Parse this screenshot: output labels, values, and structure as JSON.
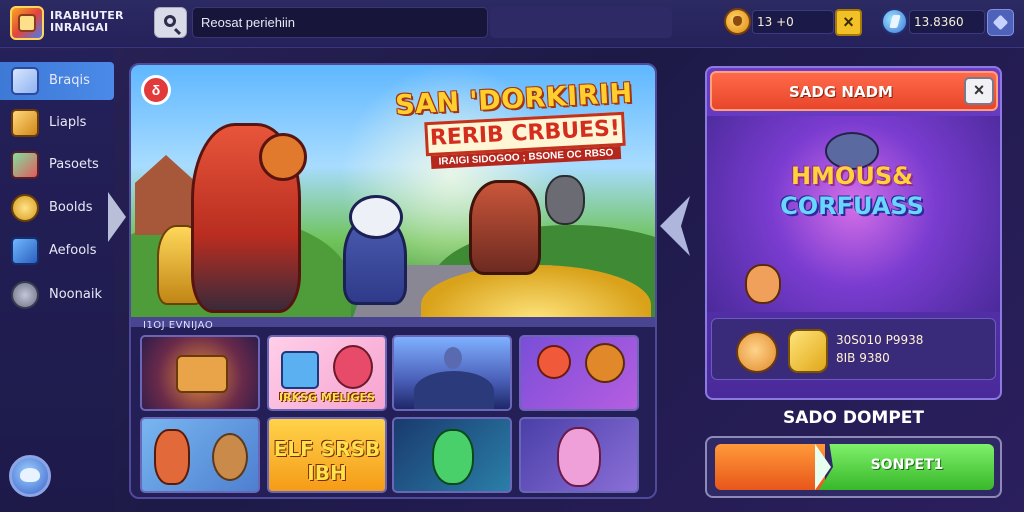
{
  "app": {
    "title": "IRABHUTER INRAIGAI"
  },
  "search": {
    "value": "Reosat periehiin",
    "placeholder": "Reosat periehiin"
  },
  "currency": {
    "primary_value": "13 +0",
    "secondary_value": "13.8360",
    "primary_icon": "coin-icon",
    "secondary_icon": "gem-icon"
  },
  "sidebar": {
    "items": [
      {
        "label": "Braqis",
        "icon": "book-icon"
      },
      {
        "label": "Liapls",
        "icon": "chest-icon"
      },
      {
        "label": "Pasoets",
        "icon": "gift-icon"
      },
      {
        "label": "Boolds",
        "icon": "medal-icon"
      },
      {
        "label": "Aefools",
        "icon": "cards-icon"
      },
      {
        "label": "Noonaik",
        "icon": "controller-icon"
      }
    ]
  },
  "banner": {
    "title": "SAN 'DORKIRIH",
    "subtitle": "RERIB CRBUES!",
    "tagline": "IRAIGI SIDOGOO ; BSONE OC RBSO",
    "badge": "δ"
  },
  "games": {
    "section_label": "I1OJ EVNIJAO",
    "tiles": [
      {
        "caption": ""
      },
      {
        "caption": "IRKSG  MELIGES"
      },
      {
        "caption": ""
      },
      {
        "caption": ""
      },
      {
        "caption": ""
      },
      {
        "caption": "ELF SRSB IBH"
      },
      {
        "caption": ""
      },
      {
        "caption": ""
      }
    ]
  },
  "promo": {
    "title": "SADG NADM",
    "close": "×",
    "logo_line1": "HMOUS&",
    "logo_line2": "CORFUASS",
    "stat1": "30S010 P9938",
    "stat2": "8IB 9380"
  },
  "wallet": {
    "title": "SADO DOMPET",
    "button_label": "SONPET1"
  },
  "colors": {
    "accent_blue": "#4b8ae8",
    "accent_orange": "#e8462a",
    "accent_green": "#38b82a",
    "panel_purple": "#6a3cc8",
    "coin_gold": "#f2c128"
  }
}
